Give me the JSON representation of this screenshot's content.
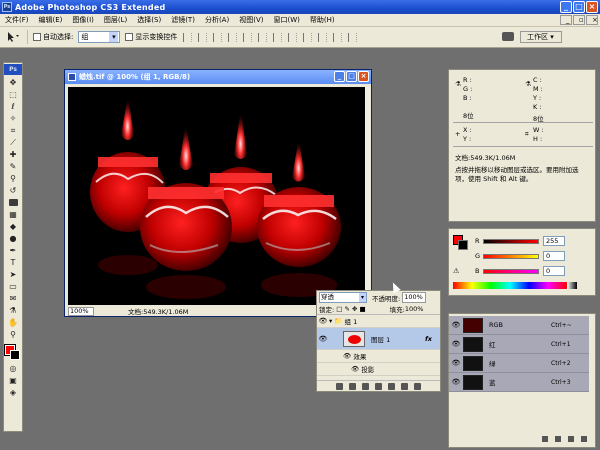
{
  "app": {
    "title": "Adobe Photoshop CS3 Extended",
    "icon": "Ps"
  },
  "menu": [
    "文件(F)",
    "编辑(E)",
    "图像(I)",
    "图层(L)",
    "选择(S)",
    "滤镜(T)",
    "分析(A)",
    "视图(V)",
    "窗口(W)",
    "帮助(H)"
  ],
  "options": {
    "auto_select_label": "自动选择:",
    "auto_select_value": "组",
    "show_transform_label": "显示变换控件",
    "workspace_label": "工作区 ▾"
  },
  "document": {
    "title": "蜡烛.tif @ 100% (组 1, RGB/8)",
    "zoom": "100%",
    "info": "文档:549.3K/1.06M"
  },
  "layers_panel": {
    "blend_mode": "穿透",
    "opacity_label": "不透明度:",
    "opacity_value": "100%",
    "lock_label": "锁定:",
    "fill_label": "填充:",
    "fill_value": "100%",
    "rows": [
      {
        "name": "组 1",
        "type": "group"
      },
      {
        "name": "图层 1",
        "type": "layer",
        "fx": "fx"
      },
      {
        "name": "效果",
        "type": "effect"
      },
      {
        "name": "投影",
        "type": "effect-item"
      }
    ]
  },
  "info_panel": {
    "r": "R :",
    "g": "G :",
    "b": "B :",
    "c": "C :",
    "m": "M :",
    "y": "Y :",
    "k": "K :",
    "x": "X :",
    "y2": "Y :",
    "w": "W :",
    "h": "H :",
    "bit_left": "8位",
    "bit_right": "8位",
    "doc": "文档:549.3K/1.06M",
    "hint": "点按并拖移以移动图层或选区。要用附加选项，使用 Shift 和 Alt 键。"
  },
  "color_panel": {
    "r_label": "R",
    "r_value": "255",
    "g_label": "G",
    "g_value": "0",
    "b_label": "B",
    "b_value": "0",
    "fg": "#ff0000",
    "bg": "#000000"
  },
  "channels_panel": {
    "rows": [
      {
        "name": "RGB",
        "shortcut": "Ctrl+~"
      },
      {
        "name": "红",
        "shortcut": "Ctrl+1"
      },
      {
        "name": "绿",
        "shortcut": "Ctrl+2"
      },
      {
        "name": "蓝",
        "shortcut": "Ctrl+3"
      }
    ]
  }
}
